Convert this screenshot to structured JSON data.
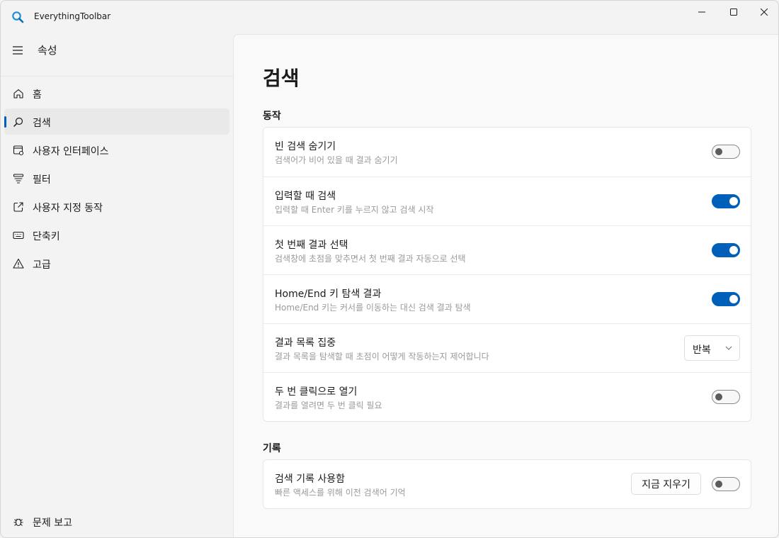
{
  "window": {
    "title": "EverythingToolbar",
    "accent_color": "#005fb8"
  },
  "nav": {
    "header": "속성",
    "items": [
      {
        "label": "홈",
        "icon": "home-icon"
      },
      {
        "label": "검색",
        "icon": "search-icon",
        "selected": true
      },
      {
        "label": "사용자 인터페이스",
        "icon": "ui-settings-icon"
      },
      {
        "label": "필터",
        "icon": "filter-icon"
      },
      {
        "label": "사용자 지정 동작",
        "icon": "open-external-icon"
      },
      {
        "label": "단축키",
        "icon": "keyboard-icon"
      },
      {
        "label": "고급",
        "icon": "warning-icon"
      }
    ],
    "footer": {
      "label": "문제 보고",
      "icon": "bug-icon"
    }
  },
  "page": {
    "title": "검색",
    "sections": [
      {
        "title": "동작",
        "rows": [
          {
            "title": "빈 검색 숨기기",
            "desc": "검색어가 비어 있을 때 결과 숨기기",
            "toggle": false
          },
          {
            "title": "입력할 때 검색",
            "desc": "입력할 때 Enter 키를 누르지 않고 검색 시작",
            "toggle": true
          },
          {
            "title": "첫 번째 결과 선택",
            "desc": "검색창에 초점을 맞추면서 첫 번째 결과 자동으로 선택",
            "toggle": true
          },
          {
            "title": "Home/End 키 탐색 결과",
            "desc": "Home/End 키는 커서를 이동하는 대신 검색 결과 탐색",
            "toggle": true
          },
          {
            "title": "결과 목록 집중",
            "desc": "결과 목록을 탐색할 때 초점이 어떻게 작동하는지 제어합니다",
            "combo_value": "반복"
          },
          {
            "title": "두 번 클릭으로 열기",
            "desc": "결과를 열려면 두 번 클릭 필요",
            "toggle": false
          }
        ]
      },
      {
        "title": "기록",
        "rows": [
          {
            "title": "검색 기록 사용함",
            "desc": "빠른 액세스를 위해 이전 검색어 기억",
            "button_label": "지금 지우기",
            "toggle": false
          }
        ]
      }
    ]
  }
}
